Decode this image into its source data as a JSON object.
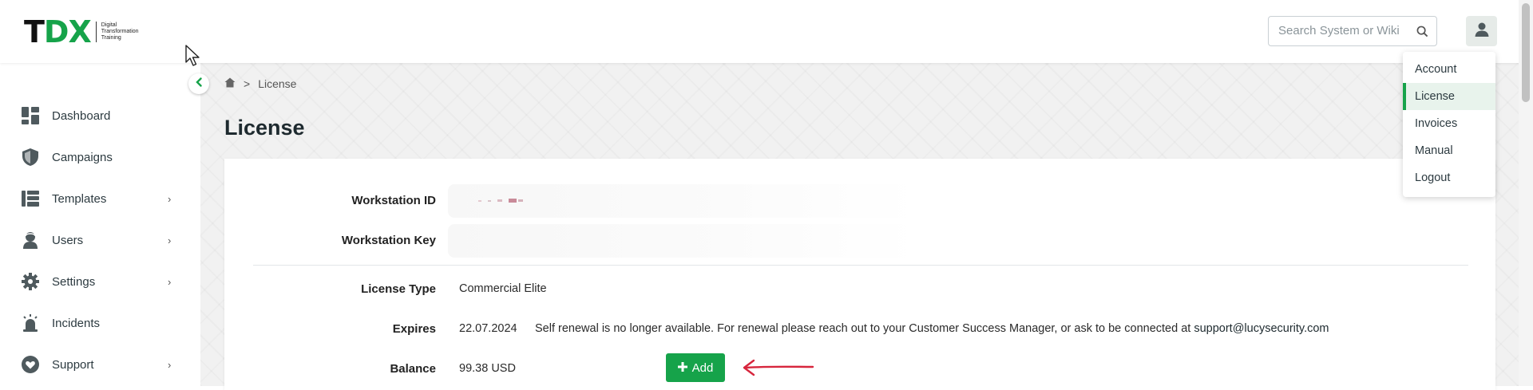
{
  "header": {
    "logo_text_t": "T",
    "logo_text_dx": "DX",
    "logo_sub": [
      "Digital",
      "Transformation",
      "Training"
    ],
    "search_placeholder": "Search System or Wiki",
    "search_icon": "search-icon",
    "user_icon": "user-icon"
  },
  "sidebar": {
    "items": [
      {
        "label": "Dashboard",
        "icon": "dashboard-icon",
        "has_submenu": false
      },
      {
        "label": "Campaigns",
        "icon": "shield-icon",
        "has_submenu": false
      },
      {
        "label": "Templates",
        "icon": "templates-icon",
        "has_submenu": true
      },
      {
        "label": "Users",
        "icon": "users-icon",
        "has_submenu": true
      },
      {
        "label": "Settings",
        "icon": "gear-icon",
        "has_submenu": true
      },
      {
        "label": "Incidents",
        "icon": "alarm-icon",
        "has_submenu": false
      },
      {
        "label": "Support",
        "icon": "heart-bubble-icon",
        "has_submenu": true
      }
    ],
    "chevron": "›"
  },
  "breadcrumb": {
    "home_icon": "home-icon",
    "separator": ">",
    "current": "License"
  },
  "page": {
    "title": "License"
  },
  "license": {
    "workstation_id_label": "Workstation ID",
    "workstation_key_label": "Workstation Key",
    "license_type_label": "License Type",
    "license_type_value": "Commercial Elite",
    "expires_label": "Expires",
    "expires_date": "22.07.2024",
    "expires_note": "Self renewal is no longer available. For renewal please reach out to your Customer Success Manager, or ask to be connected at",
    "support_email": "support@lucysecurity.com",
    "balance_label": "Balance",
    "balance_value": "99.38 USD",
    "add_button_label": "Add"
  },
  "dropdown": {
    "items": [
      {
        "label": "Account",
        "active": false
      },
      {
        "label": "License",
        "active": true
      },
      {
        "label": "Invoices",
        "active": false
      },
      {
        "label": "Manual",
        "active": false
      },
      {
        "label": "Logout",
        "active": false
      }
    ]
  },
  "colors": {
    "accent": "#16a34a",
    "annotation_arrow": "#d7263d"
  }
}
